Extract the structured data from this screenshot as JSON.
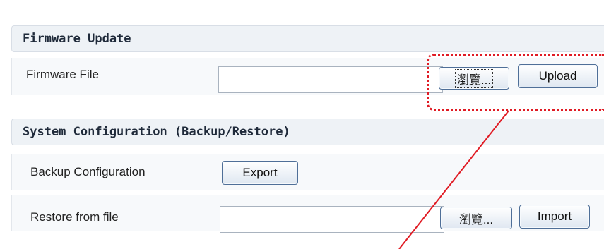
{
  "firmware_section": {
    "title": "Firmware Update",
    "file_label": "Firmware File",
    "file_value": "",
    "browse_label": "瀏覽...",
    "upload_label": "Upload"
  },
  "config_section": {
    "title": "System Configuration (Backup/Restore)",
    "backup_label": "Backup Configuration",
    "export_label": "Export",
    "restore_label": "Restore from file",
    "restore_value": "",
    "browse_label": "瀏覽...",
    "import_label": "Import"
  },
  "annotation": {
    "highlight_color": "#e01b24"
  }
}
